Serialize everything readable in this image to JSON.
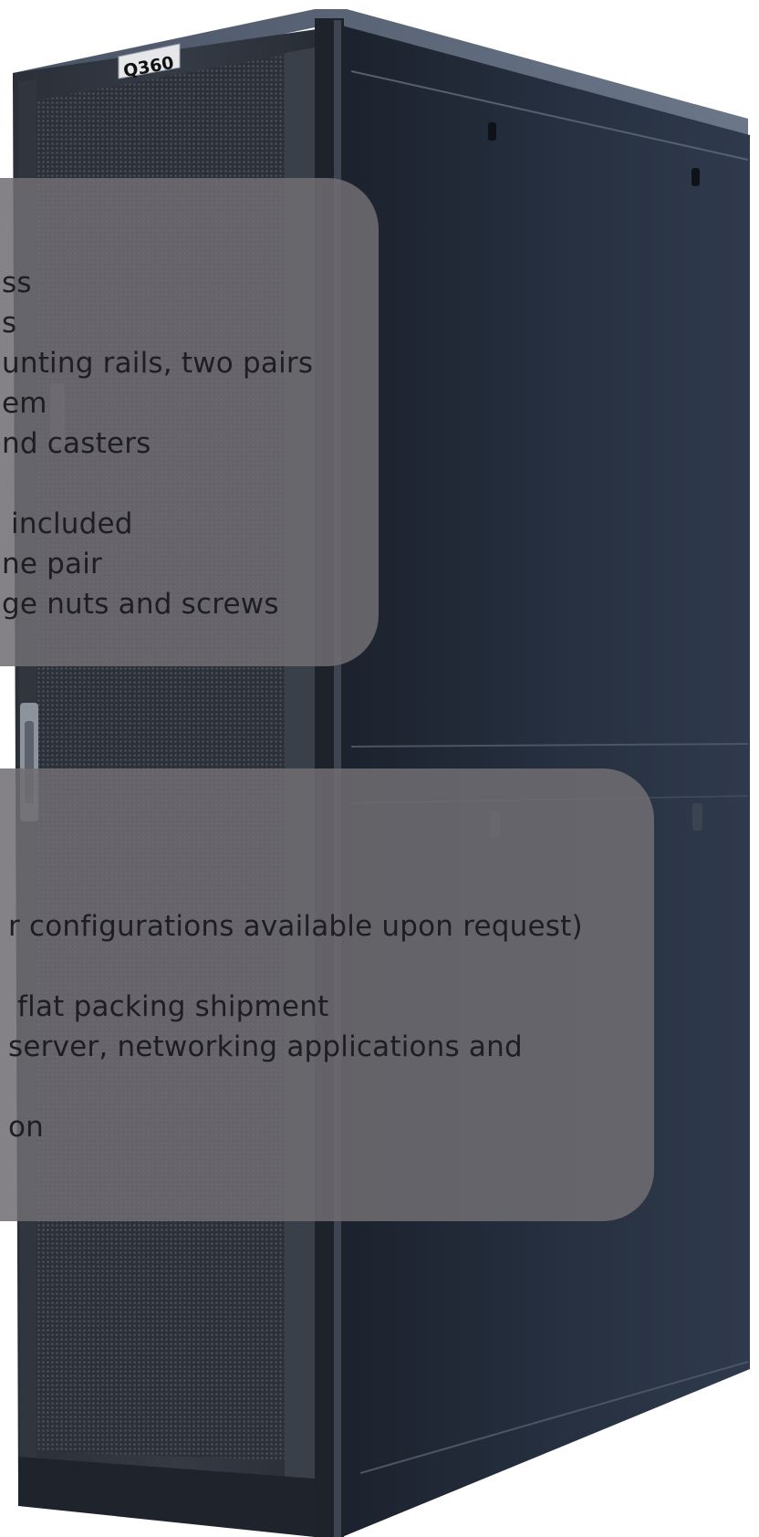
{
  "product": {
    "logo_text": "Q360"
  },
  "features_top": [
    "ss",
    "s",
    "unting rails, two pairs",
    "em",
    "nd casters",
    "",
    " included",
    "ne pair",
    "ge nuts and screws"
  ],
  "features_bottom": [
    "r configurations available upon request)",
    "",
    " flat packing shipment",
    "server, networking applications and",
    "",
    "on"
  ],
  "colors": {
    "rack_body": "#262c38",
    "rack_side": "#1f2530",
    "door_mesh": "#3a3f48",
    "card_overlay": "#706e72",
    "card_text": "#1e1e22"
  },
  "icons": {
    "logo": "q360-logo-plate",
    "door_handle": "door-handle-icon"
  }
}
